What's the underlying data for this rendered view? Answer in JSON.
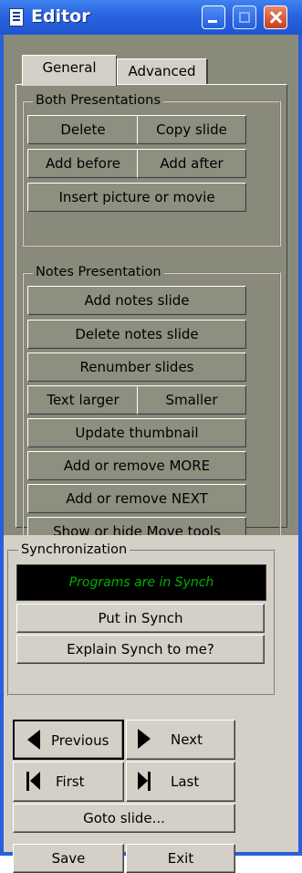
{
  "window": {
    "title": "Editor",
    "icon": "document-icon",
    "controls": [
      "minimize-icon",
      "maximize-icon",
      "close-icon"
    ]
  },
  "tabs": [
    {
      "label": "General",
      "selected": true
    },
    {
      "label": "Advanced",
      "selected": false
    }
  ],
  "both": {
    "legend": "Both Presentations",
    "delete": "Delete",
    "copy_slide": "Copy slide",
    "add_before": "Add before",
    "add_after": "Add after",
    "insert_picture": "Insert picture or movie"
  },
  "notes": {
    "legend": "Notes Presentation",
    "add_notes": "Add notes slide",
    "delete_notes": "Delete notes slide",
    "renumber": "Renumber slides",
    "text_larger": "Text larger",
    "smaller": "Smaller",
    "update_thumb": "Update thumbnail",
    "more": "Add or remove MORE",
    "next": "Add or remove NEXT",
    "move_tools": "Show or hide Move tools"
  },
  "sync": {
    "legend": "Synchronization",
    "status": "Programs are in Synch",
    "status_color": "#00b000",
    "put_in_synch": "Put in Synch",
    "explain": "Explain Synch to me?"
  },
  "navigation": {
    "previous": "Previous",
    "next": "Next",
    "first": "First",
    "last": "Last",
    "goto": "Goto slide..."
  },
  "footer": {
    "save": "Save",
    "exit": "Exit"
  }
}
